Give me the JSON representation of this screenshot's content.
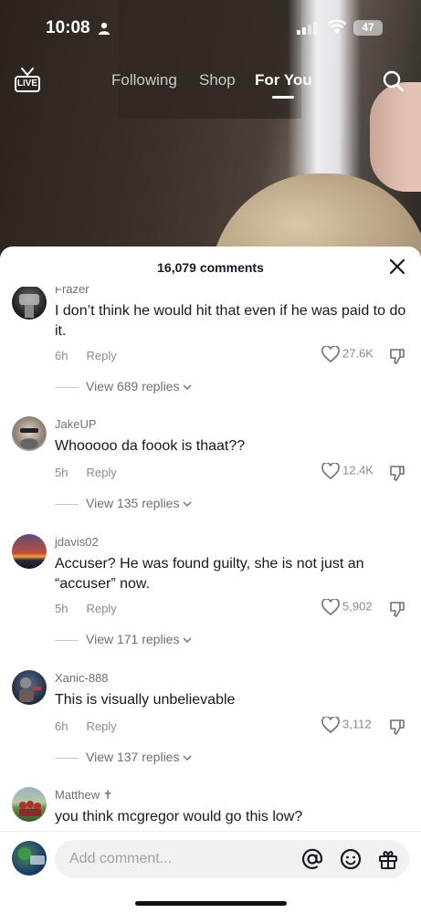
{
  "status_bar": {
    "time": "10:08",
    "battery": "47"
  },
  "top_nav": {
    "live_label": "LIVE",
    "tabs": [
      {
        "label": "Following",
        "active": false
      },
      {
        "label": "Shop",
        "active": false
      },
      {
        "label": "For You",
        "active": true
      }
    ]
  },
  "comments_sheet": {
    "title": "16,079 comments",
    "comments": [
      {
        "username": "Frazer",
        "text": "I don’t think he would hit that even if he was paid to do it.",
        "age": "6h",
        "reply_label": "Reply",
        "likes": "27.6K",
        "view_replies": "View 689 replies"
      },
      {
        "username": "JakeUP",
        "text": "Whooooo da foook is thaat??",
        "age": "5h",
        "reply_label": "Reply",
        "likes": "12.4K",
        "view_replies": "View 135 replies"
      },
      {
        "username": "jdavis02",
        "text": "Accuser? He was found guilty, she is not just an “accuser” now.",
        "age": "5h",
        "reply_label": "Reply",
        "likes": "5,902",
        "view_replies": "View 171 replies"
      },
      {
        "username": "Xanic-888",
        "text": "This is visually unbelievable",
        "age": "6h",
        "reply_label": "Reply",
        "likes": "3,112",
        "view_replies": "View 137 replies"
      },
      {
        "username": "Matthew ✝",
        "text": "you think mcgregor would go this low?"
      }
    ]
  },
  "composer": {
    "placeholder": "Add comment..."
  }
}
